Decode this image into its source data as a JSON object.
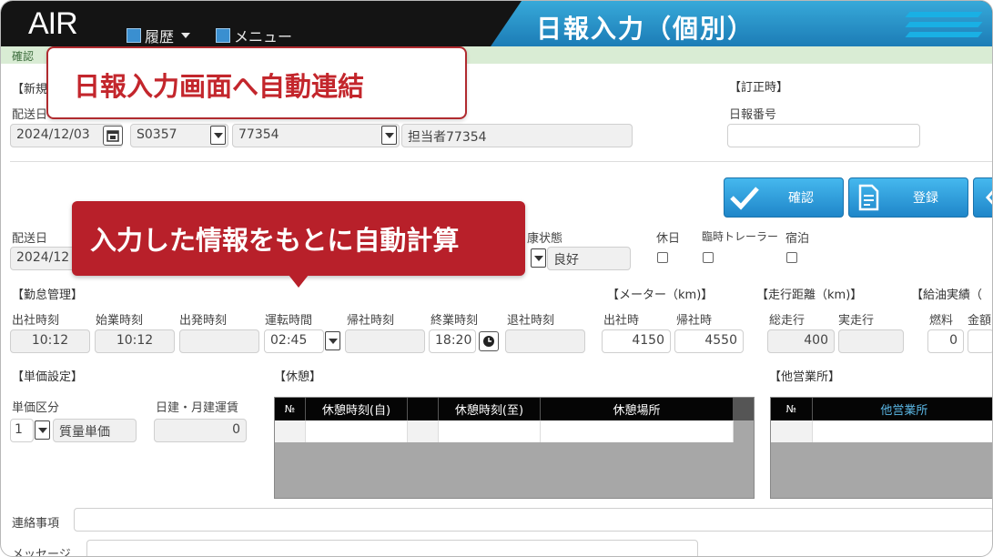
{
  "header": {
    "logo": "AIR",
    "menu_history": "履歴",
    "menu_main": "メニュー",
    "title": "日報入力（個別）"
  },
  "confirm_bar": "確認",
  "top": {
    "new_label": "【新規",
    "correction_label": "【訂正時】",
    "date_label": "配送日",
    "report_no_label": "日報番号",
    "date_value": "2024/12/03",
    "vehicle_code": "S0357",
    "staff_code": "77354",
    "staff_name": "担当者77354",
    "report_no_value": ""
  },
  "buttons": {
    "confirm": "確認",
    "register": "登録"
  },
  "row2": {
    "date_label": "配送日",
    "date_value": "2024/12",
    "health_label": "康状態",
    "health_value": "良好",
    "holiday_label": "休日",
    "trailer_label": "臨時トレーラー",
    "stay_label": "宿泊"
  },
  "attendance": {
    "section": "【勤怠管理】",
    "labels": [
      "出社時刻",
      "始業時刻",
      "出発時刻",
      "運転時間",
      "帰社時刻",
      "終業時刻",
      "退社時刻"
    ],
    "arrive": "10:12",
    "start": "10:12",
    "depart": "",
    "drive": "02:45",
    "return": "",
    "end": "18:20",
    "leave": ""
  },
  "meter": {
    "section": "【メーター（km)】",
    "label_out": "出社時",
    "label_in": "帰社時",
    "out": "4150",
    "in": "4550"
  },
  "distance": {
    "section": "【走行距離（km)】",
    "label_total": "総走行",
    "label_actual": "実走行",
    "total": "400",
    "actual": ""
  },
  "fuel": {
    "section": "【給油実績（",
    "label_fuel": "燃料",
    "label_amount": "金額",
    "fuel": "0"
  },
  "unit_price": {
    "section": "【単価設定】",
    "class_label": "単価区分",
    "fare_label": "日建・月建運賃",
    "class_code": "1",
    "class_name": "質量単価",
    "fare_value": "0"
  },
  "rest": {
    "section": "【休憩】",
    "cols": [
      "№",
      "休憩時刻(自)",
      "休憩時刻(至)",
      "休憩場所"
    ]
  },
  "other_office": {
    "section": "【他営業所】",
    "cols": [
      "№",
      "他営業所"
    ]
  },
  "bottom": {
    "contact_label": "連絡事項",
    "message_label": "メッセージ"
  },
  "callouts": {
    "link": "日報入力画面へ自動連結",
    "calc": "入力した情報をもとに自動計算"
  }
}
